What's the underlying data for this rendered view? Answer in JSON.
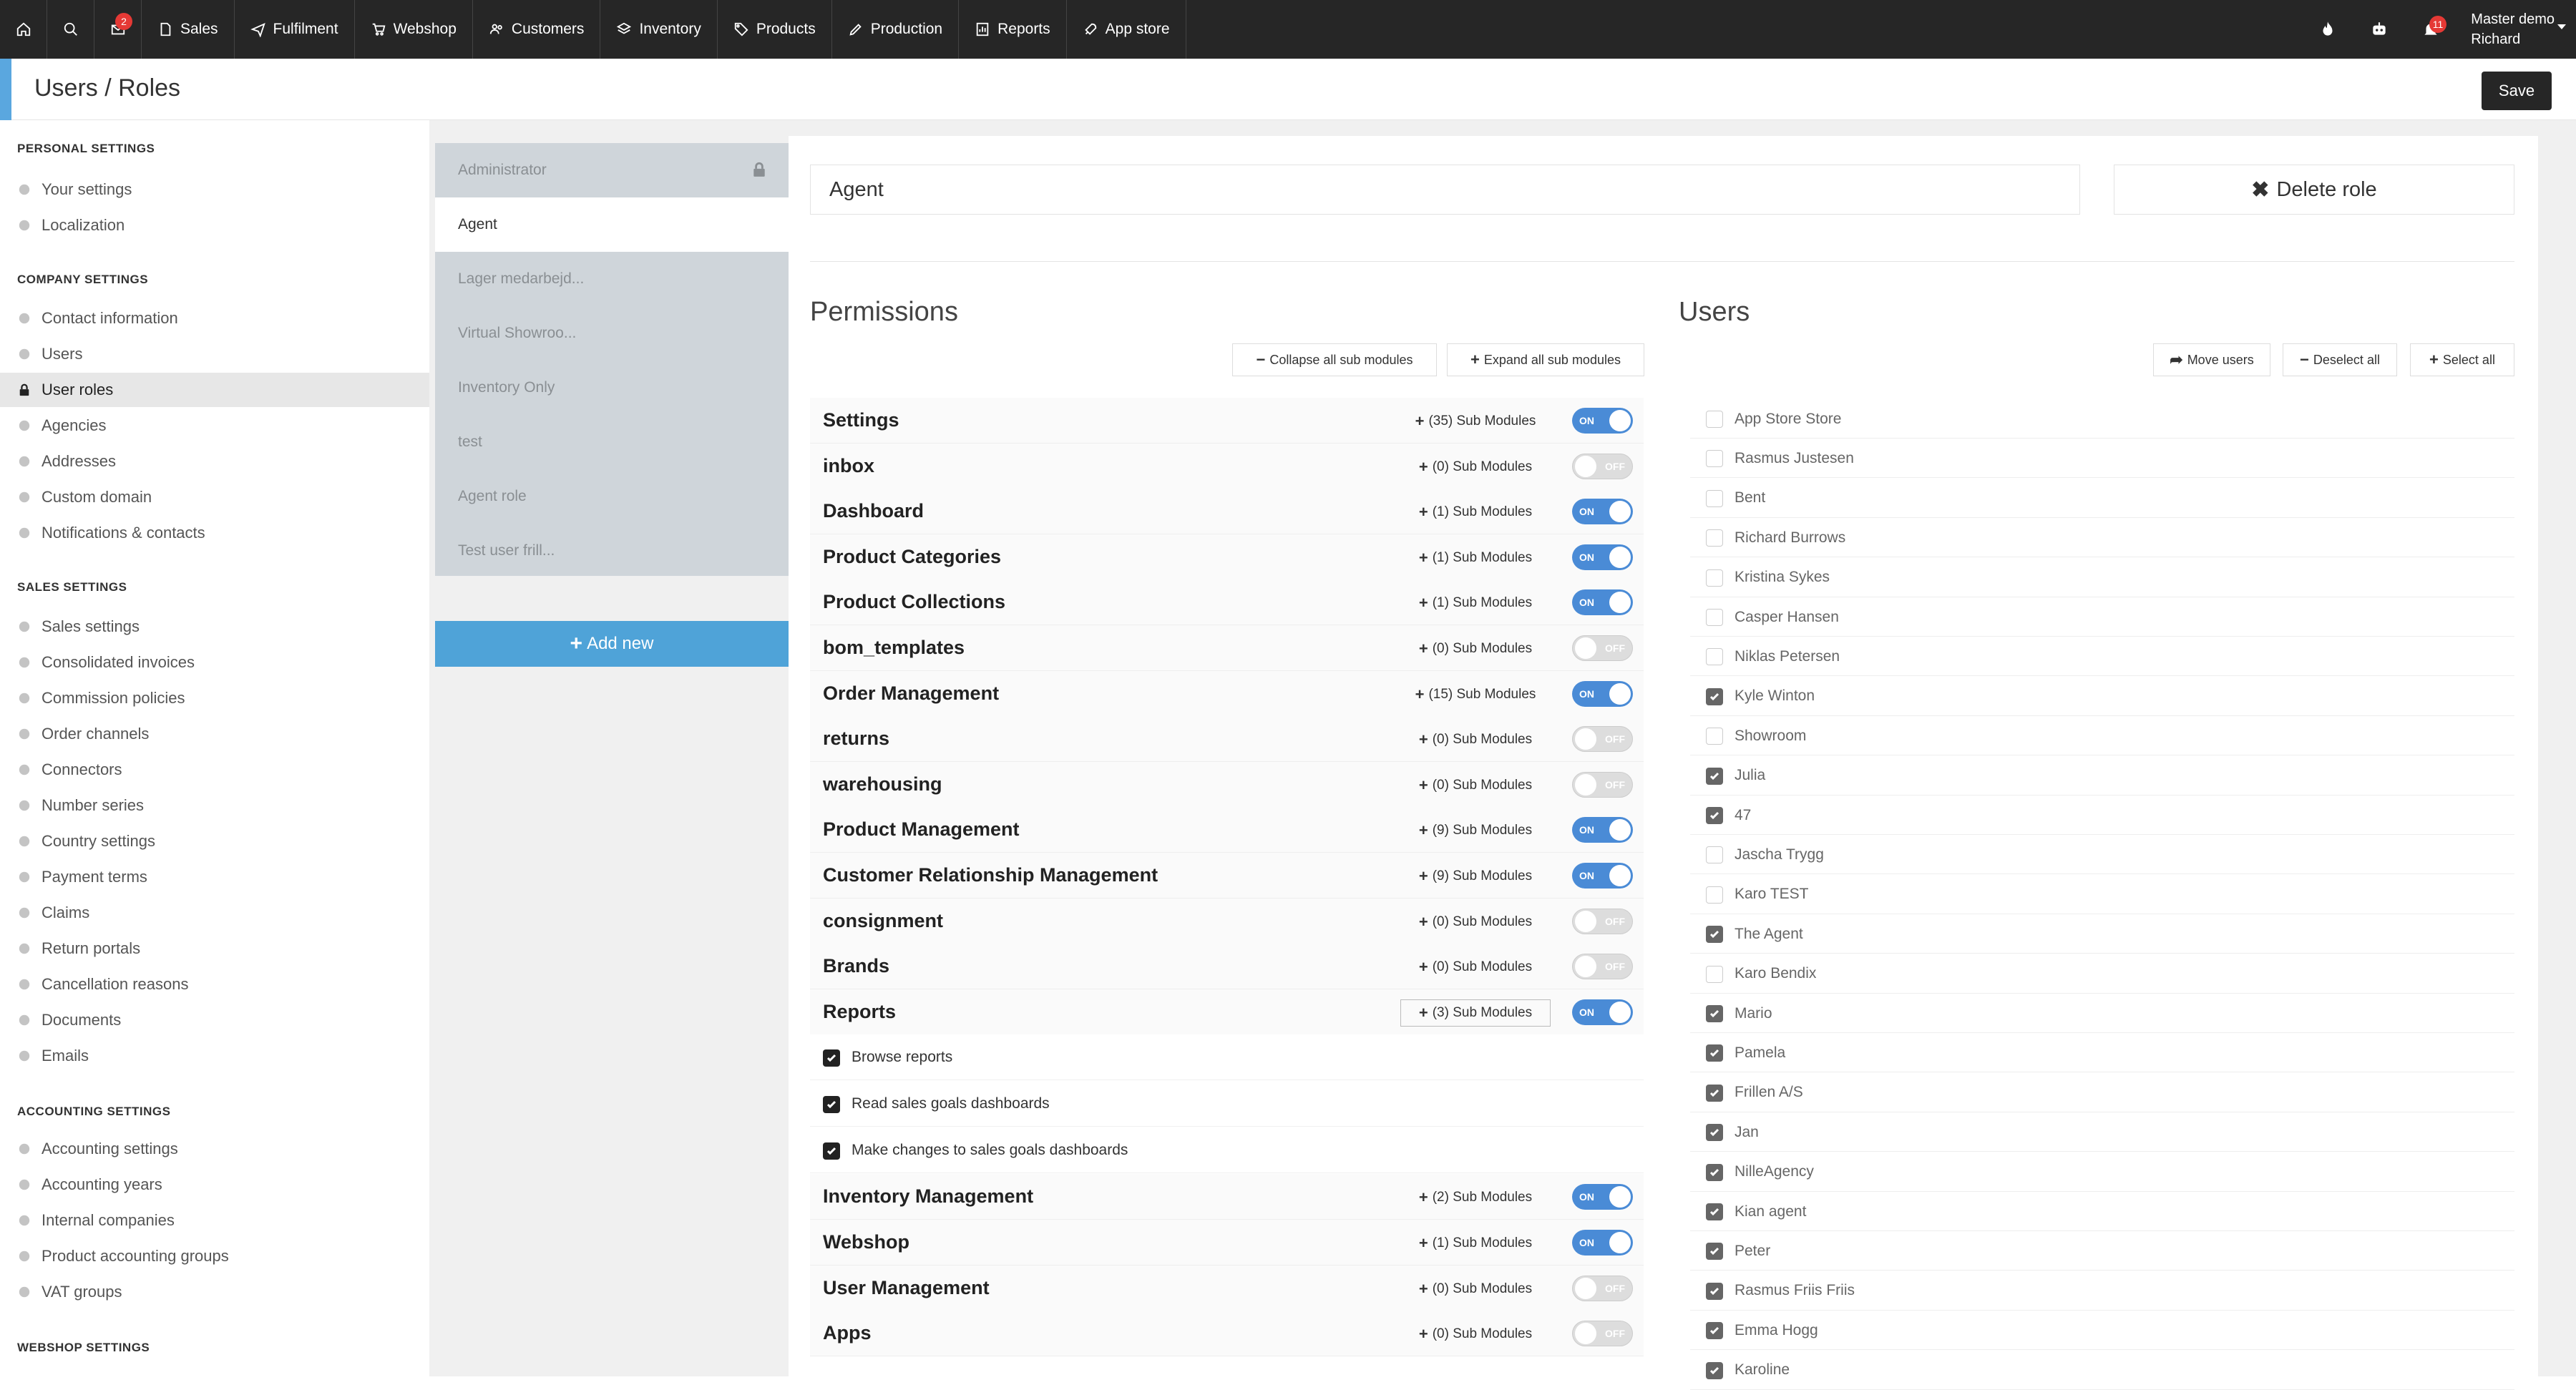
{
  "nav": {
    "inbox_badge": "2",
    "items": [
      {
        "label": "Sales",
        "icon": "document-icon"
      },
      {
        "label": "Fulfilment",
        "icon": "paper-plane-icon"
      },
      {
        "label": "Webshop",
        "icon": "cart-icon"
      },
      {
        "label": "Customers",
        "icon": "users-icon"
      },
      {
        "label": "Inventory",
        "icon": "layers-icon"
      },
      {
        "label": "Products",
        "icon": "tag-icon"
      },
      {
        "label": "Production",
        "icon": "pencil-icon"
      },
      {
        "label": "Reports",
        "icon": "report-icon"
      },
      {
        "label": "App store",
        "icon": "rocket-icon"
      }
    ],
    "notifications_badge": "11",
    "company": "Master demo",
    "user": "Richard"
  },
  "header": {
    "title": "Users / Roles",
    "save_label": "Save"
  },
  "sidebar": {
    "personal_heading": "PERSONAL SETTINGS",
    "personal": [
      {
        "label": "Your settings",
        "icon": "gear-icon"
      },
      {
        "label": "Localization",
        "icon": "globe-icon"
      }
    ],
    "company_heading": "COMPANY SETTINGS",
    "company": [
      {
        "label": "Contact information",
        "icon": "building-icon"
      },
      {
        "label": "Users",
        "icon": "user-icon"
      },
      {
        "label": "User roles",
        "icon": "lock-icon"
      },
      {
        "label": "Agencies",
        "icon": "globe-icon"
      },
      {
        "label": "Addresses",
        "icon": "map-icon"
      },
      {
        "label": "Custom domain",
        "icon": "link-icon"
      },
      {
        "label": "Notifications & contacts",
        "icon": "bell-icon"
      }
    ],
    "sales_heading": "SALES SETTINGS",
    "sales": [
      {
        "label": "Sales settings",
        "icon": "dollar-icon"
      },
      {
        "label": "Consolidated invoices",
        "icon": "files-icon"
      },
      {
        "label": "Commission policies",
        "icon": "money-icon"
      },
      {
        "label": "Order channels",
        "icon": "dollar-icon"
      },
      {
        "label": "Connectors",
        "icon": "exchange-icon"
      },
      {
        "label": "Number series",
        "icon": "dollar-icon"
      },
      {
        "label": "Country settings",
        "icon": "globe-icon"
      },
      {
        "label": "Payment terms",
        "icon": "list-icon"
      },
      {
        "label": "Claims",
        "icon": "refresh-icon"
      },
      {
        "label": "Return portals",
        "icon": "refresh-icon"
      },
      {
        "label": "Cancellation reasons",
        "icon": "help-icon"
      },
      {
        "label": "Documents",
        "icon": "document-icon"
      },
      {
        "label": "Emails",
        "icon": "send-icon"
      }
    ],
    "accounting_heading": "ACCOUNTING SETTINGS",
    "accounting": [
      {
        "label": "Accounting settings",
        "icon": "gear-icon"
      },
      {
        "label": "Accounting years",
        "icon": "list-icon"
      },
      {
        "label": "Internal companies",
        "icon": "home-icon"
      },
      {
        "label": "Product accounting groups",
        "icon": "folder-icon"
      },
      {
        "label": "VAT groups",
        "icon": "folder-icon"
      }
    ],
    "webshop_heading": "WEBSHOP SETTINGS"
  },
  "roles": [
    "Administrator",
    "Agent",
    "Lager medarbejd...",
    "Virtual Showroo...",
    "Inventory Only",
    "test",
    "Agent role",
    "Test user frill..."
  ],
  "add_new_label": "Add new",
  "role_name": "Agent",
  "delete_role_label": "Delete role",
  "permissions": {
    "title": "Permissions",
    "collapse_label": "Collapse all sub modules",
    "expand_label": "Expand all sub modules",
    "on_label": "ON",
    "off_label": "OFF",
    "rows": [
      {
        "name": "Settings",
        "sub": "(35) Sub Modules",
        "on": true
      },
      {
        "name": "inbox",
        "sub": "(0) Sub Modules",
        "on": false
      },
      {
        "name": "Dashboard",
        "sub": "(1) Sub Modules",
        "on": true
      },
      {
        "name": "Product Categories",
        "sub": "(1) Sub Modules",
        "on": true
      },
      {
        "name": "Product Collections",
        "sub": "(1) Sub Modules",
        "on": true
      },
      {
        "name": "bom_templates",
        "sub": "(0) Sub Modules",
        "on": false
      },
      {
        "name": "Order Management",
        "sub": "(15) Sub Modules",
        "on": true
      },
      {
        "name": "returns",
        "sub": "(0) Sub Modules",
        "on": false
      },
      {
        "name": "warehousing",
        "sub": "(0) Sub Modules",
        "on": false
      },
      {
        "name": "Product Management",
        "sub": "(9) Sub Modules",
        "on": true
      },
      {
        "name": "Customer Relationship Management",
        "sub": "(9) Sub Modules",
        "on": true
      },
      {
        "name": "consignment",
        "sub": "(0) Sub Modules",
        "on": false
      },
      {
        "name": "Brands",
        "sub": "(0) Sub Modules",
        "on": false
      },
      {
        "name": "Reports",
        "sub": "(3) Sub Modules",
        "on": true
      }
    ],
    "reports_sub": [
      "Browse reports",
      "Read sales goals dashboards",
      "Make changes to sales goals dashboards"
    ],
    "rows_after": [
      {
        "name": "Inventory Management",
        "sub": "(2) Sub Modules",
        "on": true
      },
      {
        "name": "Webshop",
        "sub": "(1) Sub Modules",
        "on": true
      },
      {
        "name": "User Management",
        "sub": "(0) Sub Modules",
        "on": false
      },
      {
        "name": "Apps",
        "sub": "(0) Sub Modules",
        "on": false
      }
    ]
  },
  "users": {
    "title": "Users",
    "move_label": "Move users",
    "deselect_label": "Deselect all",
    "select_label": "Select all",
    "list": [
      {
        "name": "App Store Store",
        "checked": false
      },
      {
        "name": "Rasmus Justesen",
        "checked": false
      },
      {
        "name": "Bent",
        "checked": false
      },
      {
        "name": "Richard Burrows",
        "checked": false
      },
      {
        "name": "Kristina Sykes",
        "checked": false
      },
      {
        "name": "Casper Hansen",
        "checked": false
      },
      {
        "name": "Niklas Petersen",
        "checked": false
      },
      {
        "name": "Kyle Winton",
        "checked": true
      },
      {
        "name": "Showroom",
        "checked": false
      },
      {
        "name": "Julia",
        "checked": true
      },
      {
        "name": "47",
        "checked": true
      },
      {
        "name": "Jascha Trygg",
        "checked": false
      },
      {
        "name": "Karo TEST",
        "checked": false
      },
      {
        "name": "The Agent",
        "checked": true
      },
      {
        "name": "Karo Bendix",
        "checked": false
      },
      {
        "name": "Mario",
        "checked": true
      },
      {
        "name": "Pamela",
        "checked": true
      },
      {
        "name": "Frillen A/S",
        "checked": true
      },
      {
        "name": "Jan",
        "checked": true
      },
      {
        "name": "NilleAgency",
        "checked": true
      },
      {
        "name": "Kian agent",
        "checked": true
      },
      {
        "name": "Peter",
        "checked": true
      },
      {
        "name": "Rasmus Friis Friis",
        "checked": true
      },
      {
        "name": "Emma Hogg",
        "checked": true
      },
      {
        "name": "Karoline",
        "checked": true
      }
    ]
  }
}
